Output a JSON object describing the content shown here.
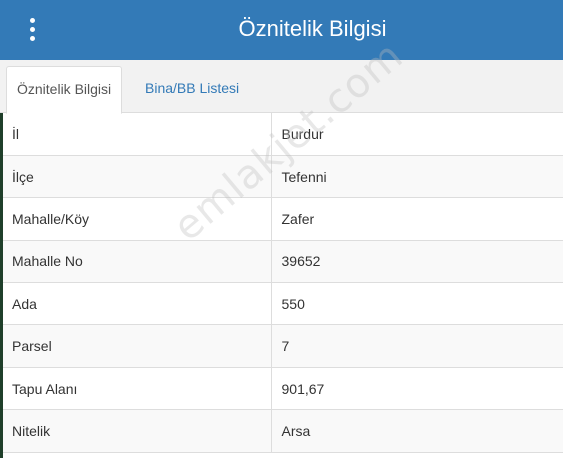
{
  "header": {
    "title": "Öznitelik Bilgisi",
    "menu_icon": "more-vertical-icon"
  },
  "tabs": [
    {
      "label": "Öznitelik Bilgisi",
      "active": true
    },
    {
      "label": "Bina/BB Listesi",
      "active": false
    }
  ],
  "attributes": [
    {
      "key": "İl",
      "value": "Burdur"
    },
    {
      "key": "İlçe",
      "value": "Tefenni"
    },
    {
      "key": "Mahalle/Köy",
      "value": "Zafer"
    },
    {
      "key": "Mahalle No",
      "value": "39652"
    },
    {
      "key": "Ada",
      "value": "550"
    },
    {
      "key": "Parsel",
      "value": "7"
    },
    {
      "key": "Tapu Alanı",
      "value": "901,67"
    },
    {
      "key": "Nitelik",
      "value": "Arsa"
    }
  ],
  "watermark": "emlakjet.com",
  "colors": {
    "header_bg": "#337ab7",
    "tab_link": "#337ab7",
    "stripe": "#f9f9f9"
  }
}
